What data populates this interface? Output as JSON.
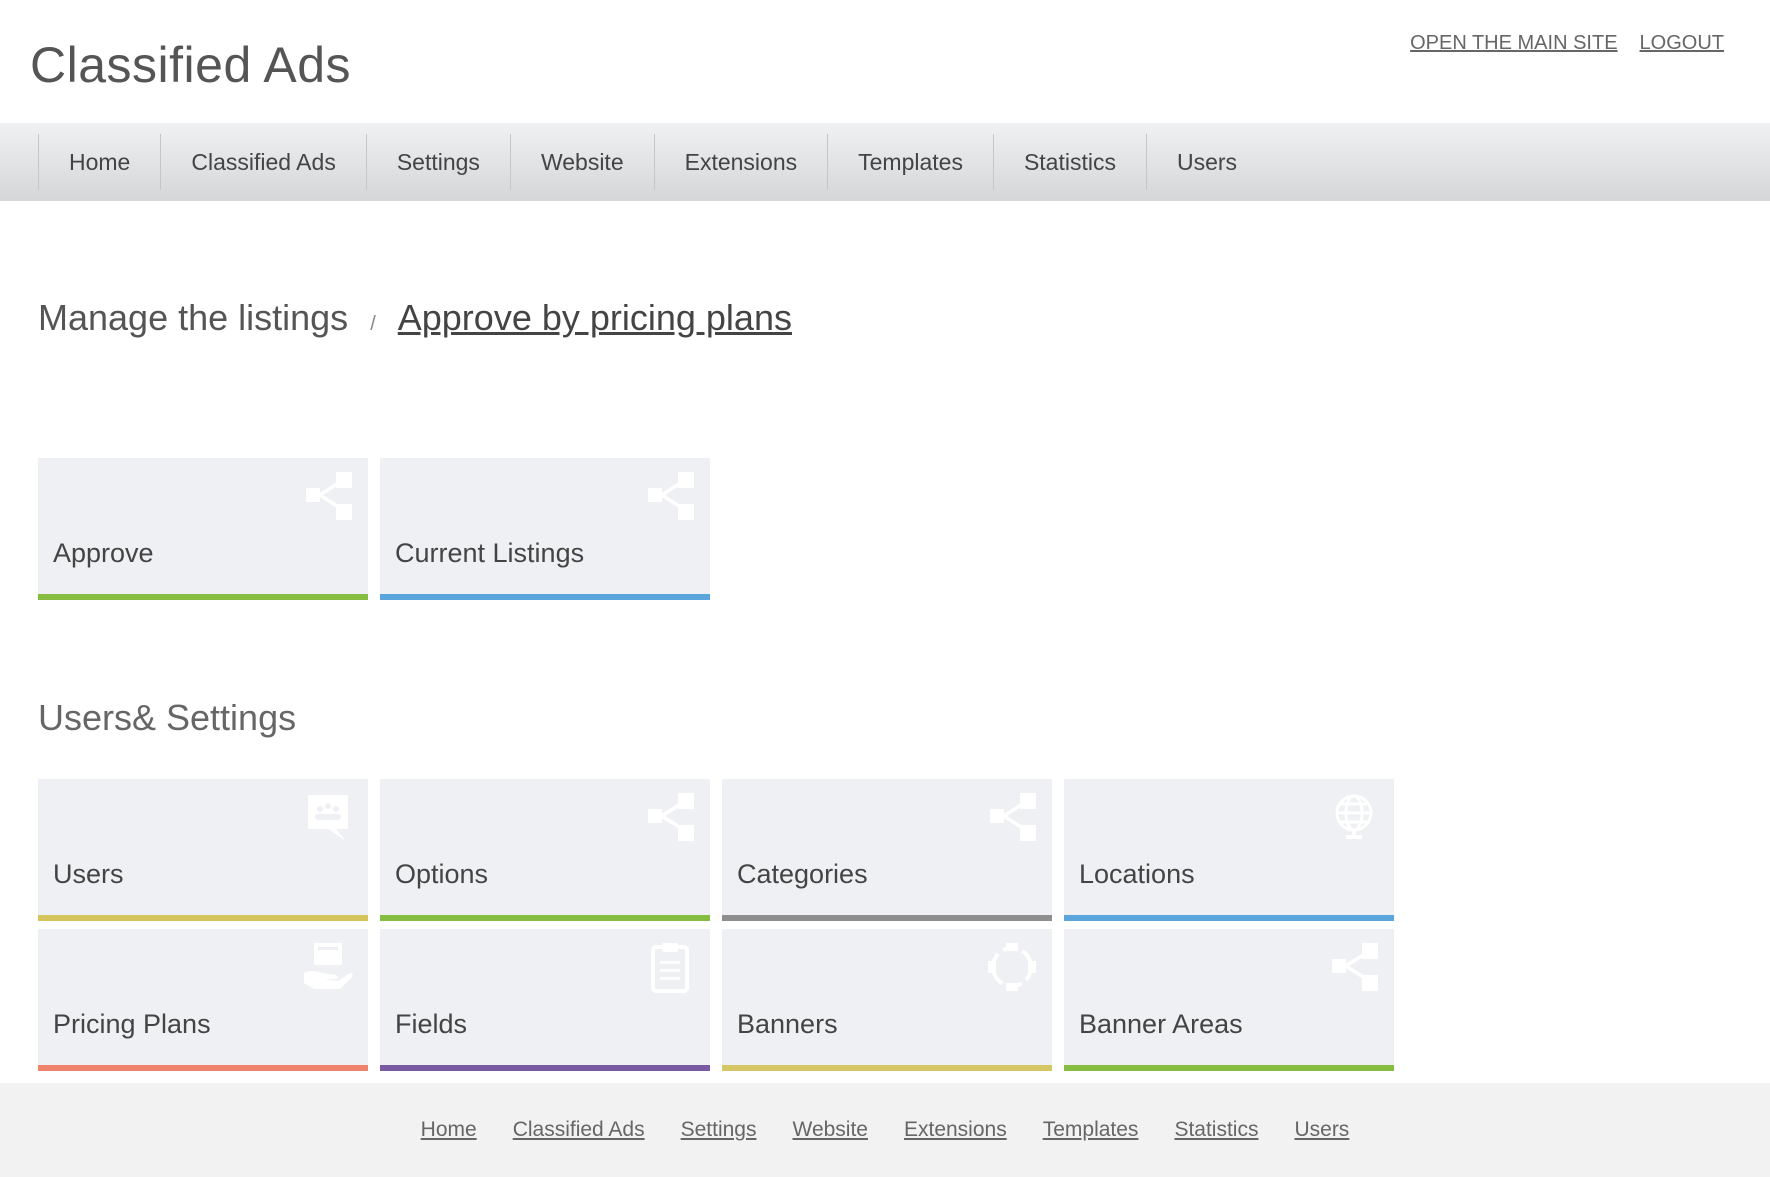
{
  "header": {
    "title": "Classified Ads",
    "links": [
      "OPEN THE MAIN SITE",
      "LOGOUT"
    ]
  },
  "nav": [
    "Home",
    "Classified Ads",
    "Settings",
    "Website",
    "Extensions",
    "Templates",
    "Statistics",
    "Users"
  ],
  "breadcrumb": {
    "root": "Manage the listings",
    "separator": "/",
    "current": "Approve by pricing plans"
  },
  "listing_tiles": [
    {
      "label": "Approve",
      "icon": "share-icon",
      "color": "#86bc3f"
    },
    {
      "label": "Current Listings",
      "icon": "share-icon",
      "color": "#5aa5db"
    }
  ],
  "settings_section": {
    "title": "Users& Settings"
  },
  "settings_tiles": [
    {
      "label": "Users",
      "icon": "chat-users-icon",
      "color": "#d6c55c"
    },
    {
      "label": "Options",
      "icon": "share-icon",
      "color": "#86bc3f"
    },
    {
      "label": "Categories",
      "icon": "share-icon",
      "color": "#8e8e8e"
    },
    {
      "label": "Locations",
      "icon": "globe-icon",
      "color": "#5aa5db"
    },
    {
      "label": "Pricing Plans",
      "icon": "hand-card-icon",
      "color": "#ef836c"
    },
    {
      "label": "Fields",
      "icon": "clipboard-icon",
      "color": "#7a5aa0"
    },
    {
      "label": "Banners",
      "icon": "focus-icon",
      "color": "#d6c766"
    },
    {
      "label": "Banner Areas",
      "icon": "share-icon",
      "color": "#86bc3f"
    }
  ],
  "footer": [
    "Home",
    "Classified Ads",
    "Settings",
    "Website",
    "Extensions",
    "Templates",
    "Statistics",
    "Users"
  ]
}
